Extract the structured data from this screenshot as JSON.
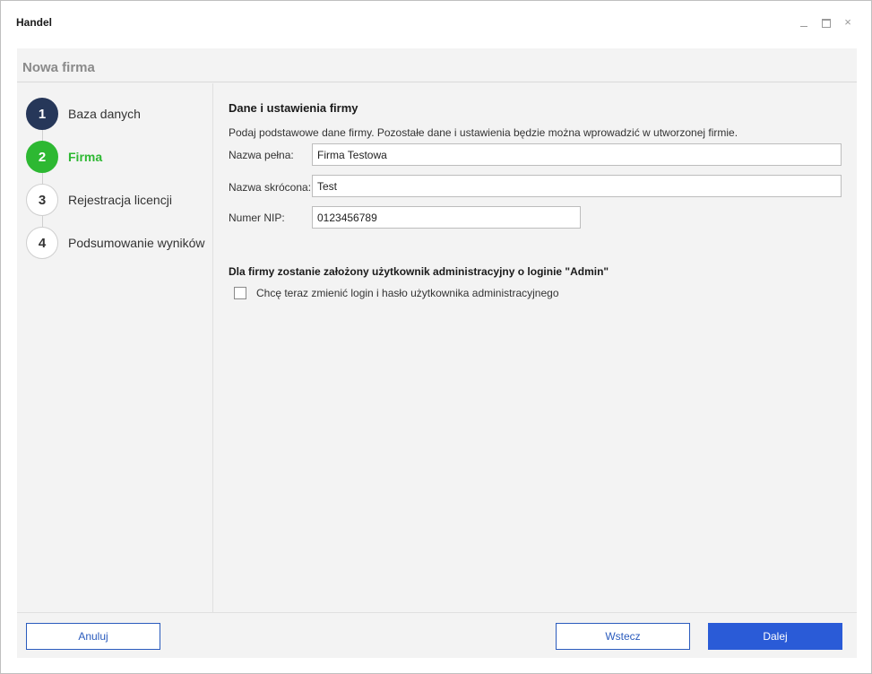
{
  "window": {
    "title": "Handel",
    "controls": {
      "minimize": "minimize-icon",
      "maximize": "maximize-icon",
      "close": "×"
    }
  },
  "dialog": {
    "title": "Nowa firma"
  },
  "steps": [
    {
      "number": "1",
      "label": "Baza danych",
      "state": "done"
    },
    {
      "number": "2",
      "label": "Firma",
      "state": "active"
    },
    {
      "number": "3",
      "label": "Rejestracja licencji",
      "state": "pending"
    },
    {
      "number": "4",
      "label": "Podsumowanie wyników",
      "state": "pending"
    }
  ],
  "form": {
    "section_title": "Dane i ustawienia firmy",
    "description": "Podaj podstawowe dane firmy. Pozostałe dane i ustawienia będzie można wprowadzić w utworzonej firmie.",
    "fields": {
      "full_name": {
        "label": "Nazwa pełna:",
        "value": "Firma Testowa"
      },
      "short_name": {
        "label": "Nazwa skrócona:",
        "value": "Test"
      },
      "nip": {
        "label": "Numer NIP:",
        "value": "0123456789"
      }
    },
    "admin_note": "Dla firmy zostanie założony użytkownik administracyjny o loginie \"Admin\"",
    "change_login_checkbox": {
      "label": "Chcę teraz zmienić login i hasło użytkownika administracyjnego",
      "checked": false
    }
  },
  "footer": {
    "cancel_label": "Anuluj",
    "back_label": "Wstecz",
    "next_label": "Dalej"
  },
  "colors": {
    "accent_blue": "#2a5bd7",
    "step_done": "#263759",
    "step_active": "#2db832"
  }
}
